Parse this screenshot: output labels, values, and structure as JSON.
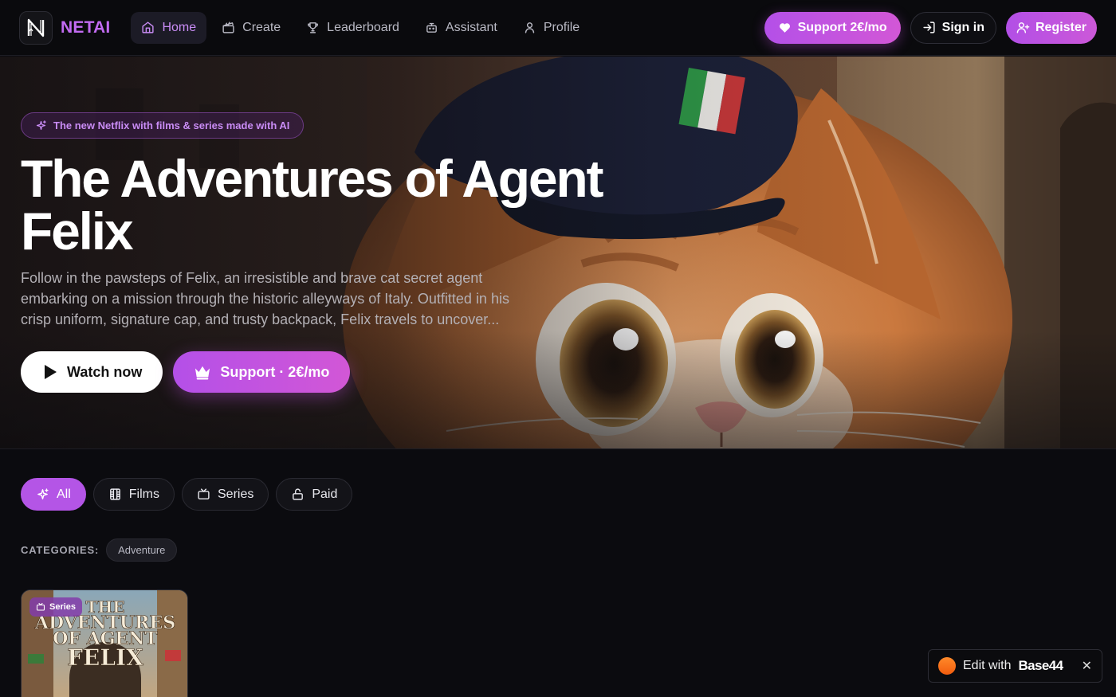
{
  "nav": {
    "brand": "NETAI",
    "links": [
      {
        "label": "Home",
        "icon": "home-icon",
        "active": true
      },
      {
        "label": "Create",
        "icon": "clapperboard-icon",
        "active": false
      },
      {
        "label": "Leaderboard",
        "icon": "trophy-icon",
        "active": false
      },
      {
        "label": "Assistant",
        "icon": "bot-icon",
        "active": false
      },
      {
        "label": "Profile",
        "icon": "user-icon",
        "active": false
      }
    ],
    "support_label": "Support 2€/mo",
    "signin_label": "Sign in",
    "register_label": "Register"
  },
  "hero": {
    "tagline": "The new Netflix with films & series made with AI",
    "title": "The Adventures of Agent Felix",
    "description": "Follow in the pawsteps of Felix, an irresistible and brave cat secret agent embarking on a mission through the historic alleyways of Italy. Outfitted in his crisp uniform, signature cap, and trusty backpack, Felix travels to uncover...",
    "watch_label": "Watch now",
    "support_label": "Support · 2€/mo"
  },
  "filters": [
    {
      "label": "All",
      "icon": "sparkles-icon",
      "active": true
    },
    {
      "label": "Films",
      "icon": "film-icon",
      "active": false
    },
    {
      "label": "Series",
      "icon": "tv-icon",
      "active": false
    },
    {
      "label": "Paid",
      "icon": "lock-icon",
      "active": false
    }
  ],
  "categories": {
    "label": "CATEGORIES:",
    "items": [
      "Adventure"
    ]
  },
  "card": {
    "badge": "Series",
    "poster_text": [
      "THE",
      "ADVENTURES",
      "OF AGENT",
      "FELIX"
    ]
  },
  "base44": {
    "prefix": "Edit with",
    "brand": "Base44",
    "close": "✕"
  },
  "colors": {
    "accent": "#b455e6",
    "brand": "#c26bf2",
    "background": "#0b0b0f"
  }
}
